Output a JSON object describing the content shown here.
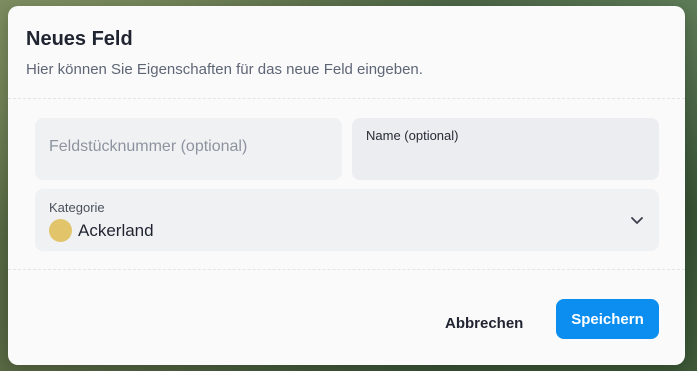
{
  "dialog": {
    "title": "Neues Feld",
    "subtitle": "Hier können Sie Eigenschaften für das neue Feld eingeben."
  },
  "form": {
    "plot_number": {
      "placeholder": "Feldstücknummer (optional)",
      "value": ""
    },
    "name": {
      "label": "Name (optional)",
      "value": ""
    },
    "category": {
      "label": "Kategorie",
      "selected": "Ackerland",
      "swatch_color": "#e2c46b",
      "icon": "chevron-down-icon"
    }
  },
  "buttons": {
    "cancel_label": "Abbrechen",
    "save_label": "Speichern"
  },
  "colors": {
    "primary": "#0b8ef0",
    "text": "#1f2430",
    "muted": "#5e6676"
  }
}
